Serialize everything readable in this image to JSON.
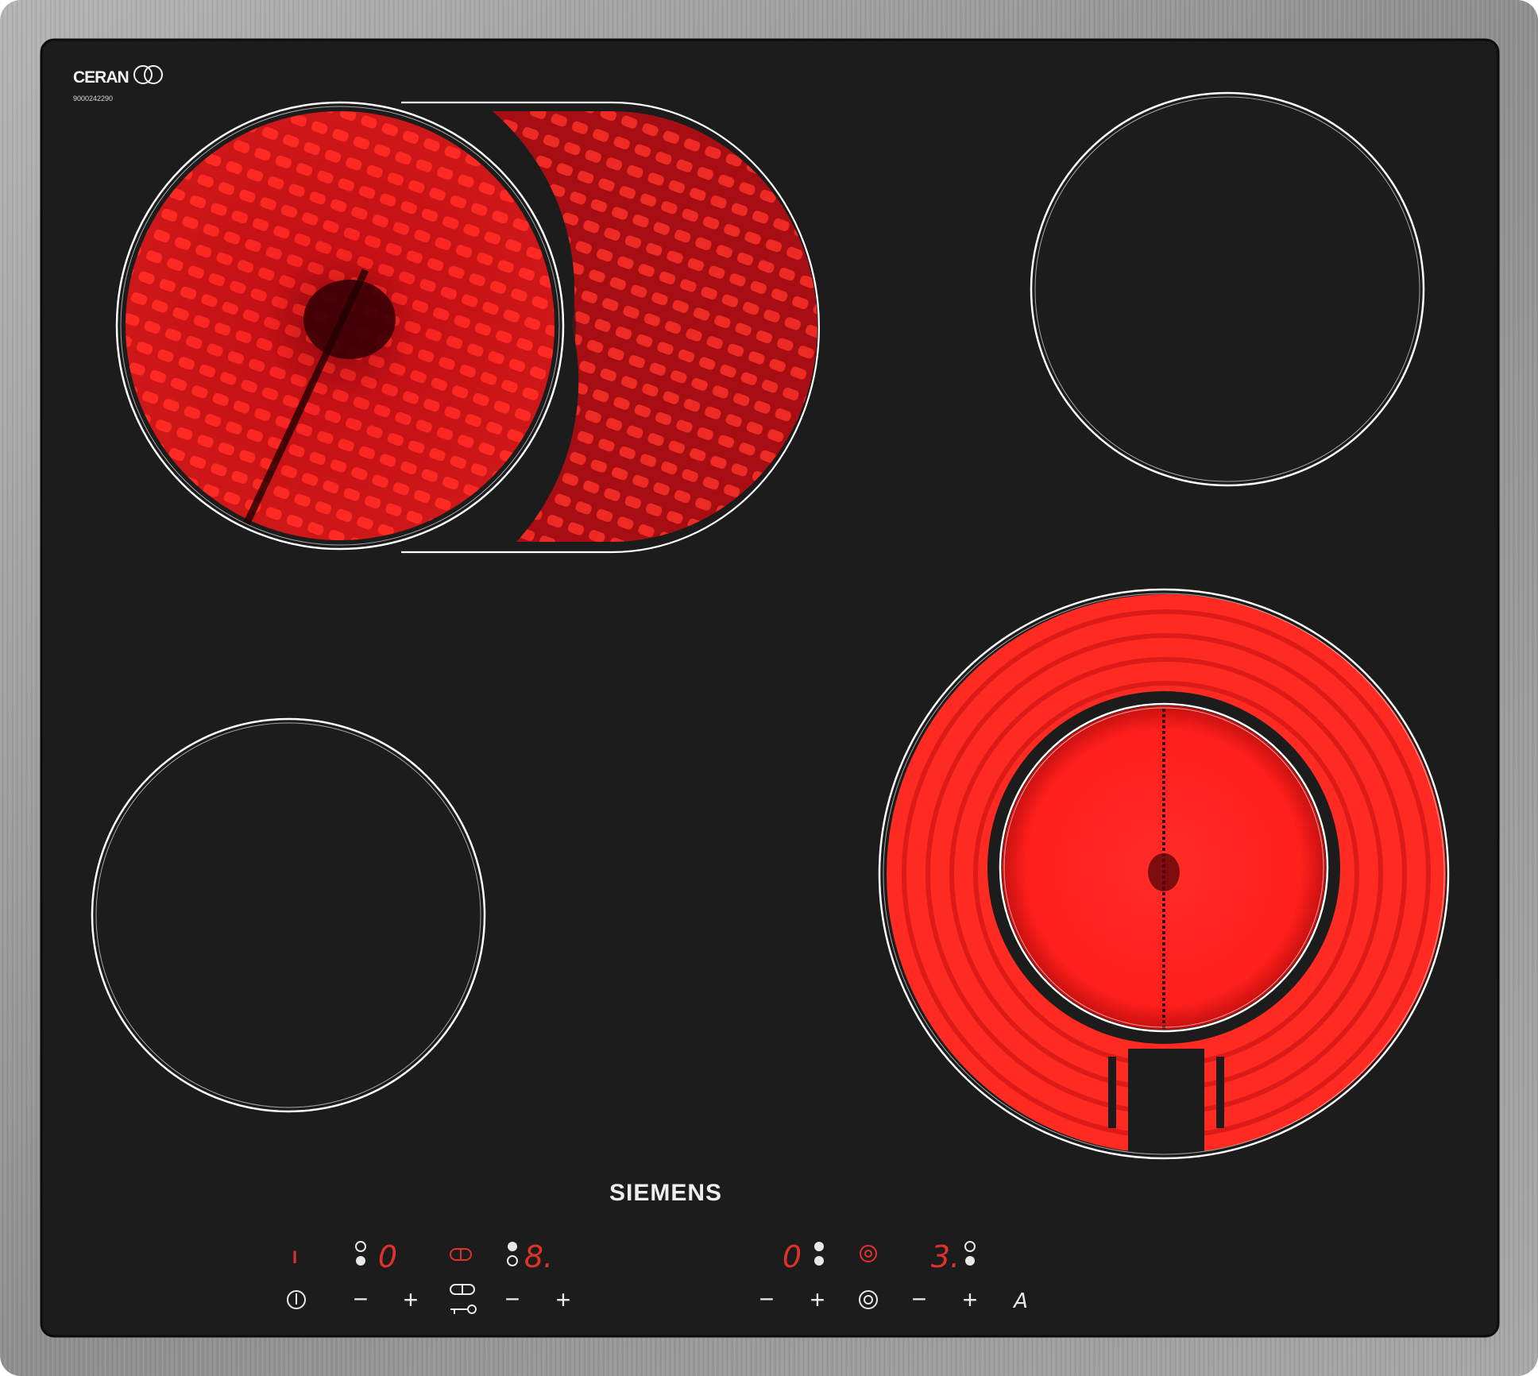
{
  "brand": {
    "ceran_logo_text": "CERAN",
    "serial": "9000242290",
    "manufacturer": "SIEMENS"
  },
  "colors": {
    "frame": "#9c9c9c",
    "glass": "#1c1c1c",
    "zone_ring": "#ffffff",
    "heat_glow": "#ff1a1a",
    "display_red": "#e0322b",
    "control_symbol": "#e8e8e8"
  },
  "zones": [
    {
      "id": "front-left-extended",
      "active": true,
      "type": "oval-dual"
    },
    {
      "id": "rear-right",
      "active": false,
      "type": "single"
    },
    {
      "id": "front-left",
      "active": false,
      "type": "single"
    },
    {
      "id": "front-right",
      "active": true,
      "type": "dual-circuit"
    }
  ],
  "display": {
    "power_indicator": "I",
    "zone1_level": "0",
    "zone2_level": "8.",
    "zone3_level": "0",
    "zone4_level": "3."
  },
  "controls": {
    "power_symbol": "power-icon",
    "minus": "−",
    "plus": "+",
    "ring_symbol": "dual-ring-icon",
    "lock_symbol": "key-lock-icon",
    "timer_label": "A"
  }
}
